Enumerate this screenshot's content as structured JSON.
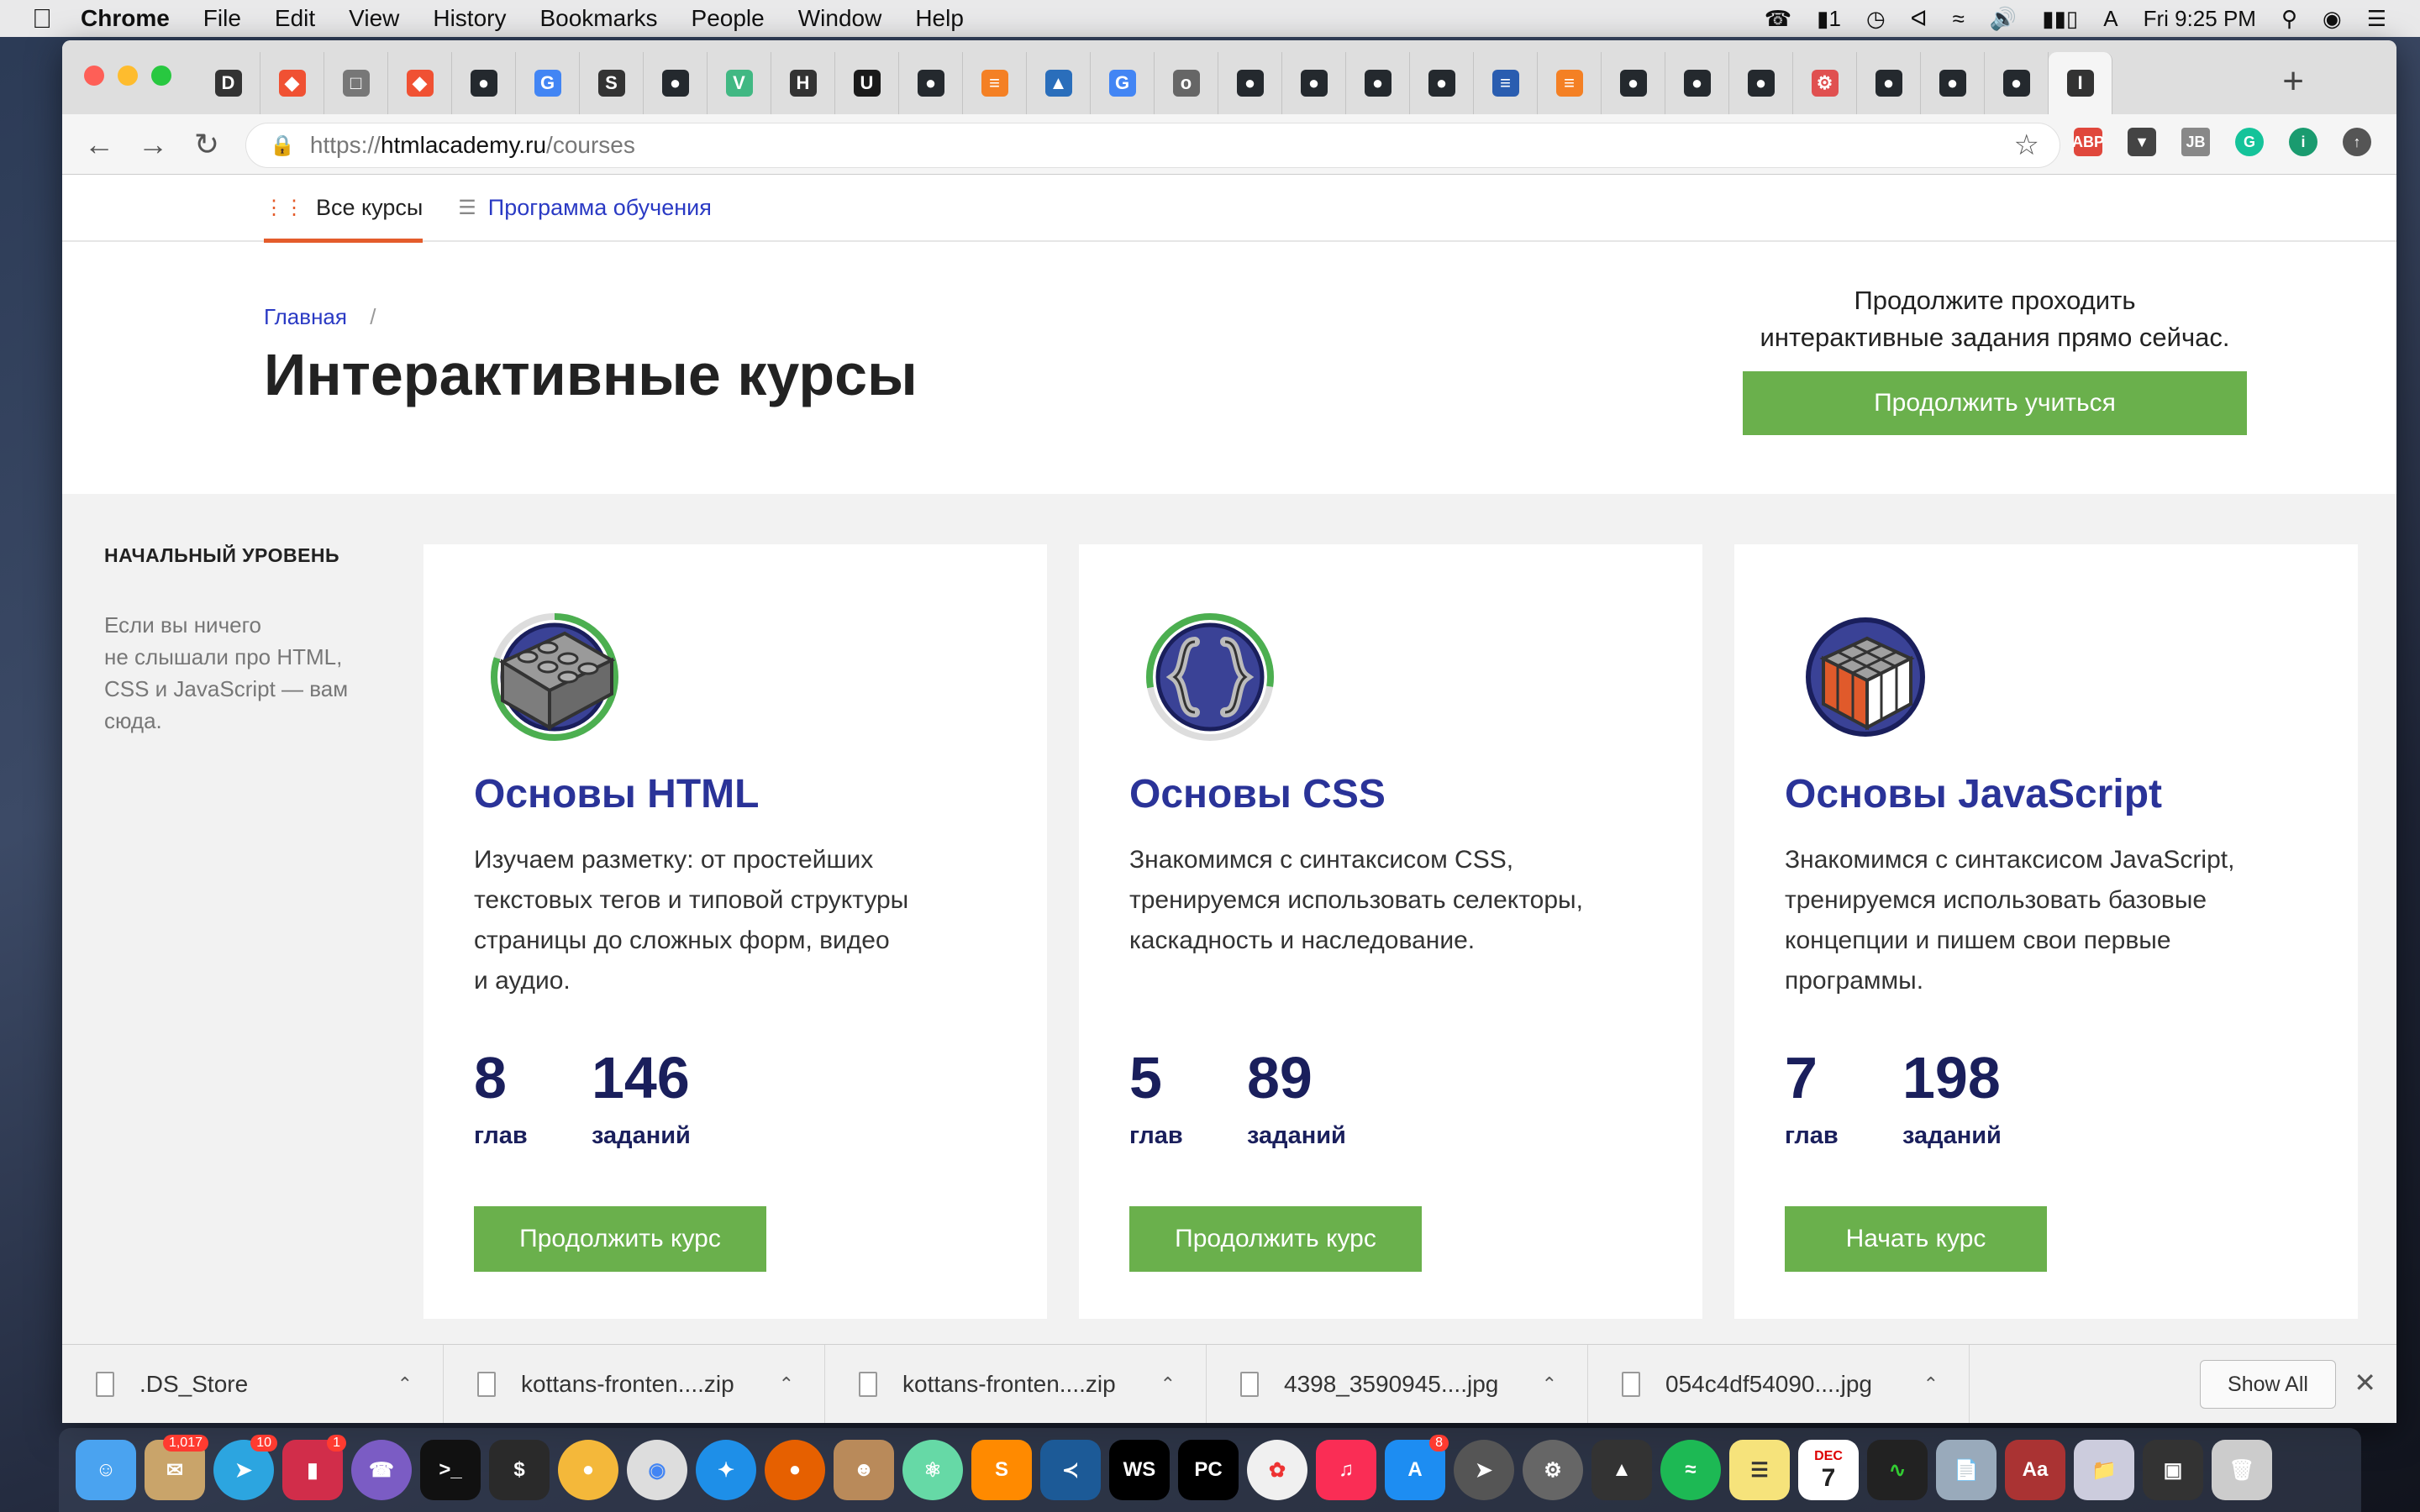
{
  "menubar": {
    "app_name": "Chrome",
    "items": [
      "File",
      "Edit",
      "View",
      "History",
      "Bookmarks",
      "People",
      "Window",
      "Help"
    ],
    "clock": "Fri 9:25 PM",
    "status_badge": "1"
  },
  "browser": {
    "url_scheme": "https://",
    "url_host": "htmlacademy.ru",
    "url_path": "/courses",
    "tabs": [
      {
        "icon": "D",
        "color": "#333333"
      },
      {
        "icon": "git",
        "color": "#f05133"
      },
      {
        "icon": "doc",
        "color": "#777777"
      },
      {
        "icon": "git",
        "color": "#f05133"
      },
      {
        "icon": "github",
        "color": "#24292e"
      },
      {
        "icon": "G",
        "color": "#4285f4"
      },
      {
        "icon": "S",
        "color": "#333333"
      },
      {
        "icon": "github",
        "color": "#24292e"
      },
      {
        "icon": "vue",
        "color": "#41b883"
      },
      {
        "icon": "H",
        "color": "#333333"
      },
      {
        "icon": "USF",
        "color": "#1a1a1a"
      },
      {
        "icon": "github",
        "color": "#24292e"
      },
      {
        "icon": "so",
        "color": "#f48024"
      },
      {
        "icon": "bird",
        "color": "#2a6ebb"
      },
      {
        "icon": "G",
        "color": "#4285f4"
      },
      {
        "icon": "o",
        "color": "#666666"
      },
      {
        "icon": "github",
        "color": "#24292e"
      },
      {
        "icon": "github",
        "color": "#24292e"
      },
      {
        "icon": "github",
        "color": "#24292e"
      },
      {
        "icon": "github",
        "color": "#24292e"
      },
      {
        "icon": "so",
        "color": "#2a5db0"
      },
      {
        "icon": "so",
        "color": "#f48024"
      },
      {
        "icon": "github",
        "color": "#24292e"
      },
      {
        "icon": "github",
        "color": "#24292e"
      },
      {
        "icon": "github",
        "color": "#24292e"
      },
      {
        "icon": "gear",
        "color": "#e05050"
      },
      {
        "icon": "github",
        "color": "#24292e"
      },
      {
        "icon": "github",
        "color": "#24292e"
      },
      {
        "icon": "github",
        "color": "#24292e"
      },
      {
        "icon": "I",
        "color": "#333333"
      }
    ]
  },
  "page": {
    "subnav": {
      "all_courses": "Все курсы",
      "curriculum": "Программа обучения"
    },
    "breadcrumb": {
      "home": "Главная",
      "separator": "/"
    },
    "title": "Интерактивные курсы",
    "promo": {
      "line1": "Продолжите проходить",
      "line2": "интерактивные задания прямо сейчас.",
      "button": "Продолжить учиться"
    },
    "level": {
      "title": "НАЧАЛЬНЫЙ УРОВЕНЬ",
      "desc_lines": [
        "Если вы ничего",
        "не слышали про HTML,",
        "CSS и JavaScript — вам",
        "сюда."
      ]
    },
    "courses": [
      {
        "name": "Основы HTML",
        "desc_lines": [
          "Изучаем разметку: от простейших",
          "текстовых тегов и типовой структуры",
          "страницы до сложных форм, видео",
          "и аудио."
        ],
        "chapters": "8",
        "chapters_label": "глав",
        "tasks": "146",
        "tasks_label": "заданий",
        "button": "Продолжить курс",
        "progress": 0.8
      },
      {
        "name": "Основы CSS",
        "desc_lines": [
          "Знакомимся с синтаксисом CSS,",
          "тренируемся использовать селекторы,",
          "каскадность и наследование."
        ],
        "chapters": "5",
        "chapters_label": "глав",
        "tasks": "89",
        "tasks_label": "заданий",
        "button": "Продолжить курс",
        "progress": 0.55
      },
      {
        "name": "Основы JavaScript",
        "desc_lines": [
          "Знакомимся с синтаксисом JavaScript,",
          "тренируемся использовать базовые",
          "концепции и пишем свои первые",
          "программы."
        ],
        "chapters": "7",
        "chapters_label": "глав",
        "tasks": "198",
        "tasks_label": "заданий",
        "button": "Начать курс",
        "progress": 0
      }
    ]
  },
  "downloads": {
    "items": [
      ".DS_Store",
      "kottans-fronten....zip",
      "kottans-fronten....zip",
      "4398_3590945....jpg",
      "054c4df54090....jpg"
    ],
    "show_all": "Show All"
  },
  "dock": {
    "badges": {
      "mail": "1,017",
      "telegram": "10",
      "app3": "1",
      "appstore": "8"
    },
    "calendar_month": "DEC",
    "calendar_day": "7"
  },
  "colors": {
    "accent_green": "#6ab04c",
    "course_title": "#2a3398",
    "link_blue": "#2a3ac4",
    "active_underline": "#e45c2b"
  }
}
